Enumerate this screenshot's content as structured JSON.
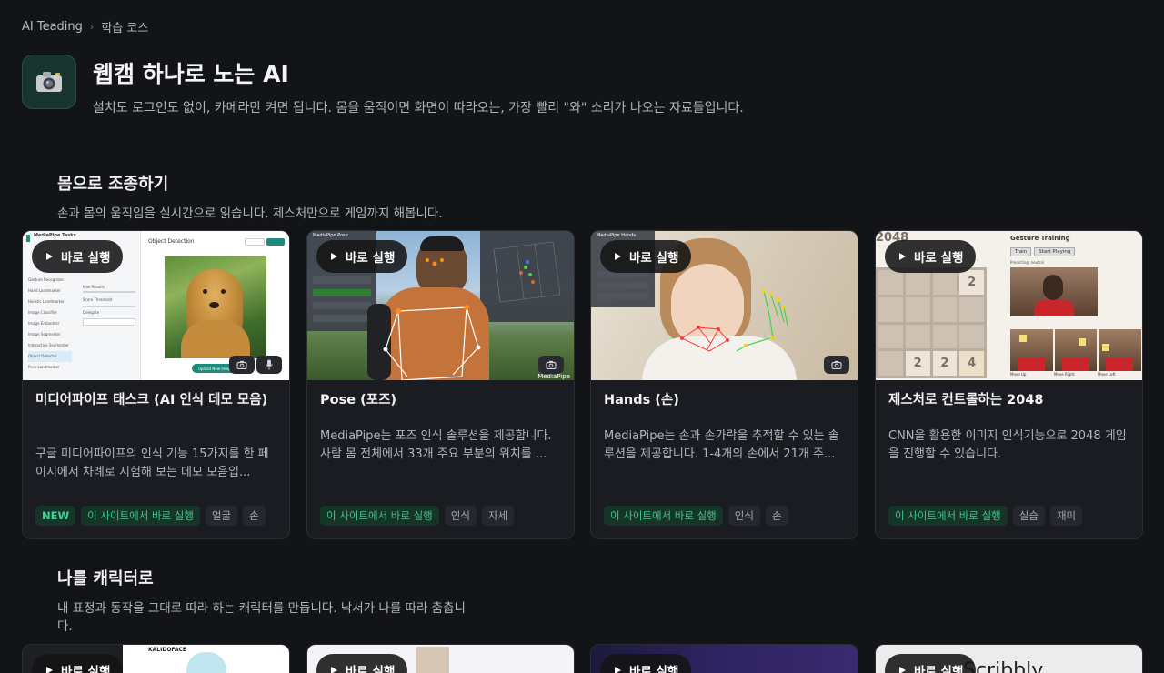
{
  "breadcrumb": {
    "root": "AI Teading",
    "separator": "›",
    "current": "학습 코스"
  },
  "header": {
    "icon": "camera-icon",
    "title": "웹캠 하나로 노는 AI",
    "subtitle": "설치도 로그인도 없이, 카메라만 켜면 됩니다. 몸을 움직이면 화면이 따라오는, 가장 빨리 \"와\" 소리가 나오는 자료들입니다."
  },
  "sections": [
    {
      "title": "몸으로 조종하기",
      "desc": "손과 몸의 움직임을 실시간으로 읽습니다. 제스처만으로 게임까지 해봅니다.",
      "cards": [
        {
          "run_label": "바로 실행",
          "title": "미디어파이프 태스크 (AI 인식 데모 모음)",
          "desc": "구글 미디어파이프의 인식 기능 15가지를 한 페이지에서 차례로 시험해 보는 데모 모음입...",
          "tags": [
            "NEW",
            "이 사이트에서 바로 실행",
            "얼굴",
            "손"
          ],
          "thumb": {
            "app_title": "MediaPipe Tasks",
            "panel_title": "Object Detection",
            "menu": [
              "Gesture Recognizer",
              "Hand Landmarker",
              "Holistic Landmarker",
              "Image Classifier",
              "Image Embedder",
              "Image Segmenter",
              "Interactive Segmenter",
              "Object Detector",
              "Pose Landmarker"
            ],
            "options": [
              "Max Results",
              "Score Threshold",
              "Delegate"
            ],
            "upload_label": "Upload New Image"
          }
        },
        {
          "run_label": "바로 실행",
          "title": "Pose (포즈)",
          "desc": "MediaPipe는 포즈 인식 솔루션을 제공합니다. 사람 몸 전체에서 33개 주요 부분의 위치를 ...",
          "tags": [
            "이 사이트에서 바로 실행",
            "인식",
            "자세"
          ],
          "thumb": {
            "app_title": "MediaPipe Pose",
            "watermark": "MediaPipe"
          }
        },
        {
          "run_label": "바로 실행",
          "title": "Hands (손)",
          "desc": "MediaPipe는 손과 손가락을 추적할 수 있는 솔루션을 제공합니다. 1-4개의 손에서 21개 주...",
          "tags": [
            "이 사이트에서 바로 실행",
            "인식",
            "손"
          ],
          "thumb": {
            "app_title": "MediaPipe Hands"
          }
        },
        {
          "run_label": "바로 실행",
          "title": "제스처로 컨트롤하는 2048",
          "desc": "CNN을 활용한 이미지 인식기능으로 2048 게임을 진행할 수 있습니다.",
          "tags": [
            "이 사이트에서 바로 실행",
            "실습",
            "재미"
          ],
          "thumb": {
            "game_title": "2048",
            "panel_title": "Gesture Training",
            "buttons": [
              "Train",
              "Start Playing"
            ],
            "tiles": [
              "2",
              "2",
              "2",
              "4"
            ],
            "caption": "Predicting: neutral",
            "webcam_labels": [
              "Move Up",
              "Move Right",
              "Move Left"
            ]
          }
        }
      ]
    },
    {
      "title": "나를 캐릭터로",
      "desc": "내 표정과 동작을 그대로 따라 하는 캐릭터를 만듭니다. 낙서가 나를 따라 춤춥니다.",
      "cards": [
        {
          "run_label": "바로 실행",
          "thumb_text": "KALIDOFACE"
        },
        {
          "run_label": "바로 실행"
        },
        {
          "run_label": "바로 실행"
        },
        {
          "run_label": "바로 실행",
          "thumb_text": "Scribbly"
        }
      ]
    }
  ],
  "colors": {
    "background": "#131417",
    "card": "#1b1c21",
    "accent_green": "#3fc58f",
    "header_icon_bg": "#17352e"
  }
}
